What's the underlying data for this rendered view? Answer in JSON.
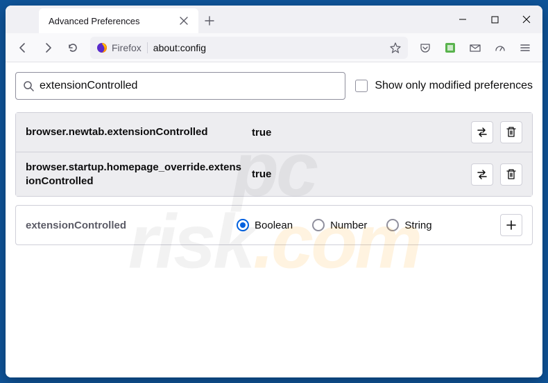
{
  "titlebar": {
    "tab_title": "Advanced Preferences"
  },
  "toolbar": {
    "identity_label": "Firefox",
    "url": "about:config"
  },
  "search": {
    "value": "extensionControlled",
    "checkbox_label": "Show only modified preferences"
  },
  "prefs": [
    {
      "name": "browser.newtab.extensionControlled",
      "value": "true"
    },
    {
      "name": "browser.startup.homepage_override.extensionControlled",
      "value": "true"
    }
  ],
  "new_pref": {
    "name": "extensionControlled",
    "types": [
      "Boolean",
      "Number",
      "String"
    ],
    "selected": "Boolean"
  },
  "watermark": {
    "line1": "pc",
    "line2": "risk",
    "suffix": ".com"
  }
}
